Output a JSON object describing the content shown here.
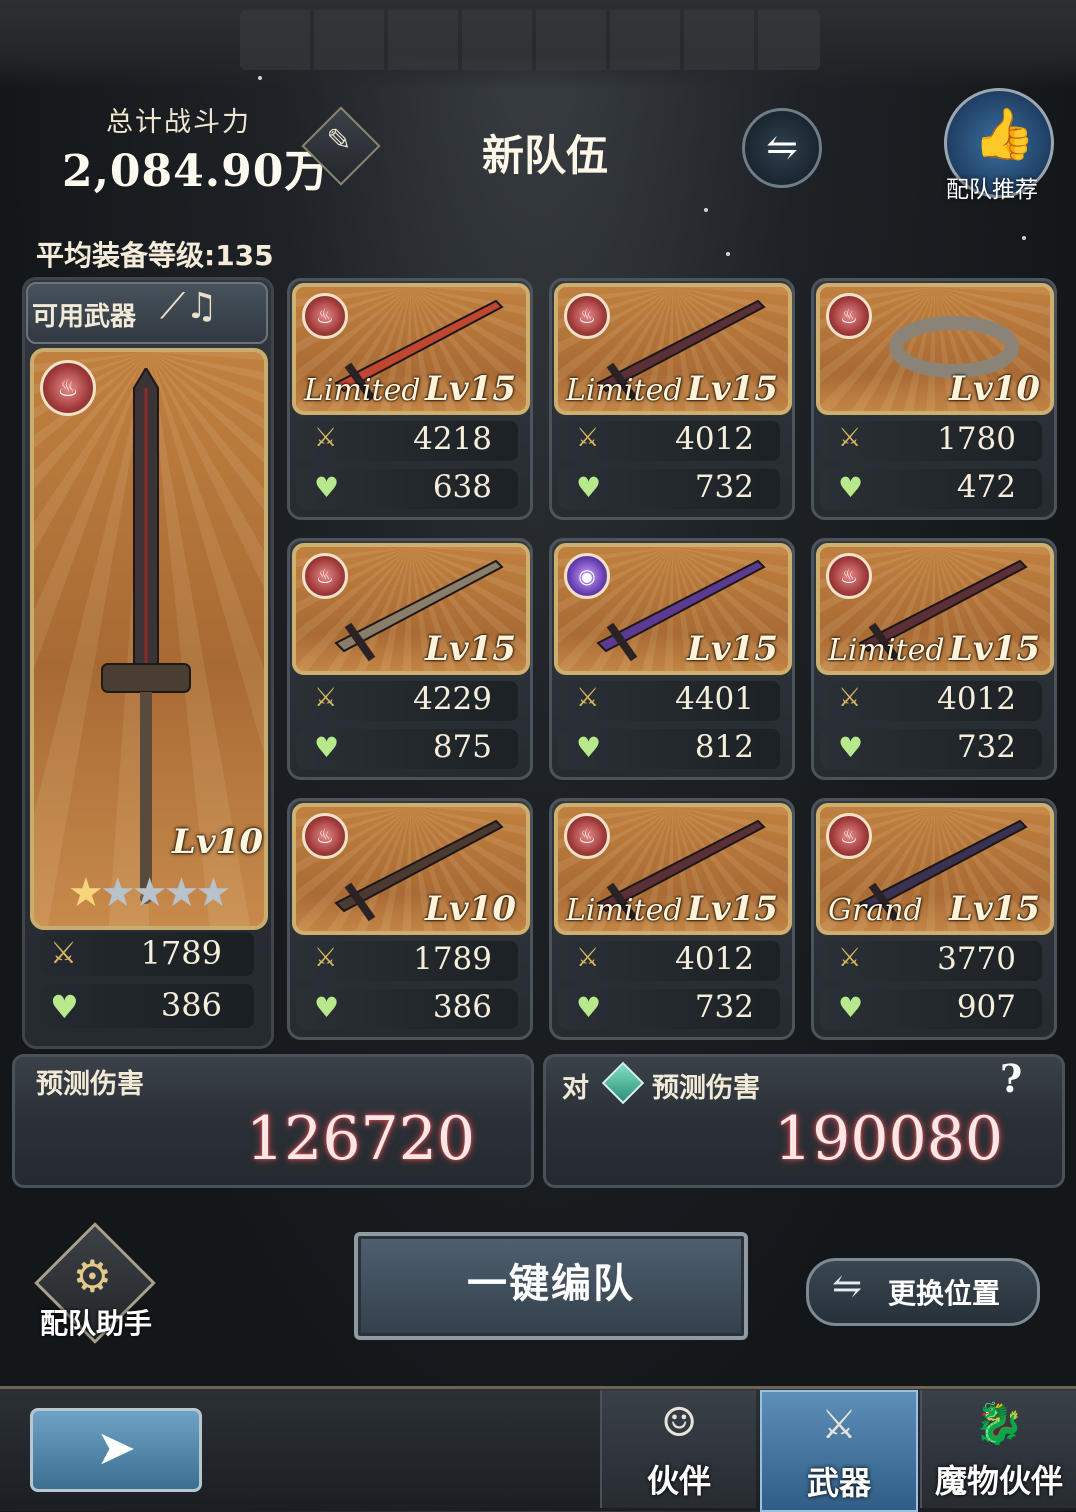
{
  "header": {
    "total_power_label": "总计战斗力",
    "total_power_value": "2,084.90万",
    "team_name": "新队伍",
    "recommend_label": "配队推荐",
    "avg_equip_level": "平均装备等级:135"
  },
  "main_weapon": {
    "section_label": "可用武器",
    "level": "Lv10",
    "stars_filled": 1,
    "stars_total": 5,
    "atk": "1789",
    "hp": "386"
  },
  "weapons": [
    {
      "tag": "Limited",
      "level": "Lv15",
      "atk": "4218",
      "hp": "638",
      "element": "fire-icon"
    },
    {
      "tag": "Limited",
      "level": "Lv15",
      "atk": "4012",
      "hp": "732",
      "element": "fire-icon"
    },
    {
      "tag": "",
      "level": "Lv10",
      "atk": "1780",
      "hp": "472",
      "element": "fire-icon"
    },
    {
      "tag": "",
      "level": "Lv15",
      "atk": "4229",
      "hp": "875",
      "element": "fire-icon"
    },
    {
      "tag": "",
      "level": "Lv15",
      "atk": "4401",
      "hp": "812",
      "element": "dark-icon"
    },
    {
      "tag": "Limited",
      "level": "Lv15",
      "atk": "4012",
      "hp": "732",
      "element": "fire-icon"
    },
    {
      "tag": "",
      "level": "Lv10",
      "atk": "1789",
      "hp": "386",
      "element": "fire-icon"
    },
    {
      "tag": "Limited",
      "level": "Lv15",
      "atk": "4012",
      "hp": "732",
      "element": "fire-icon"
    },
    {
      "tag": "Grand",
      "level": "Lv15",
      "atk": "3770",
      "hp": "907",
      "element": "fire-icon"
    }
  ],
  "damage": {
    "predicted_label": "预测伤害",
    "predicted_value": "126720",
    "vs_prefix": "对",
    "vs_label": "预测伤害",
    "vs_value": "190080",
    "help": "?"
  },
  "actions": {
    "assistant_label": "配队助手",
    "auto_team_label": "一键编队",
    "swap_position_label": "更换位置"
  },
  "nav": {
    "tabs": [
      {
        "label": "伙伴",
        "icon": "companion-icon",
        "active": false
      },
      {
        "label": "武器",
        "icon": "weapon-icon",
        "active": true
      },
      {
        "label": "魔物伙伴",
        "icon": "monster-icon",
        "active": false
      }
    ]
  },
  "colors": {
    "accent_gold": "#cdb06f",
    "damage_glow": "#c9474a",
    "active_tab": "#5e8fb8"
  }
}
